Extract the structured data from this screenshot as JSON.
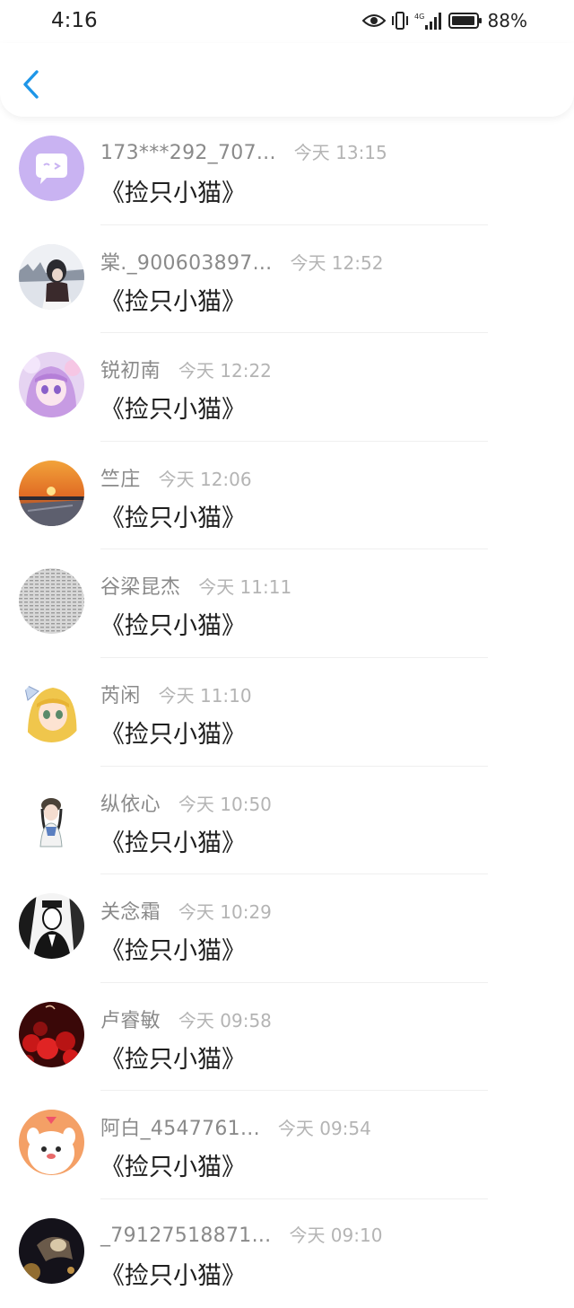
{
  "status_bar": {
    "time": "4:16",
    "battery": "88%",
    "network": "4G"
  },
  "header": {
    "back_icon": "chevron-left-icon",
    "accent_color": "#1e96e8"
  },
  "messages": [
    {
      "name": "173***292_707...",
      "time": "今天 13:15",
      "text": "《捡只小猫》",
      "avatar": "chat-bubble-avatar"
    },
    {
      "name": "棠._900603897...",
      "time": "今天 12:52",
      "text": "《捡只小猫》",
      "avatar": "girl-photo-avatar"
    },
    {
      "name": "锐初南",
      "time": "今天 12:22",
      "text": "《捡只小猫》",
      "avatar": "anime-girl-avatar"
    },
    {
      "name": "竺庄",
      "time": "今天 12:06",
      "text": "《捡只小猫》",
      "avatar": "sunset-avatar"
    },
    {
      "name": "谷梁昆杰",
      "time": "今天 11:11",
      "text": "《捡只小猫》",
      "avatar": "text-pattern-avatar"
    },
    {
      "name": "芮闲",
      "time": "今天 11:10",
      "text": "《捡只小猫》",
      "avatar": "blonde-anime-avatar"
    },
    {
      "name": "纵依心",
      "time": "今天 10:50",
      "text": "《捡只小猫》",
      "avatar": "sticker-girl-avatar"
    },
    {
      "name": "关念霜",
      "time": "今天 10:29",
      "text": "《捡只小猫》",
      "avatar": "manga-bw-avatar"
    },
    {
      "name": "卢睿敏",
      "time": "今天 09:58",
      "text": "《捡只小猫》",
      "avatar": "red-flowers-avatar"
    },
    {
      "name": "阿白_4547761...",
      "time": "今天 09:54",
      "text": "《捡只小猫》",
      "avatar": "cartoon-pet-avatar"
    },
    {
      "name": "_79127518871...",
      "time": "今天 09:10",
      "text": "《捡只小猫》",
      "avatar": "night-photo-avatar"
    }
  ]
}
